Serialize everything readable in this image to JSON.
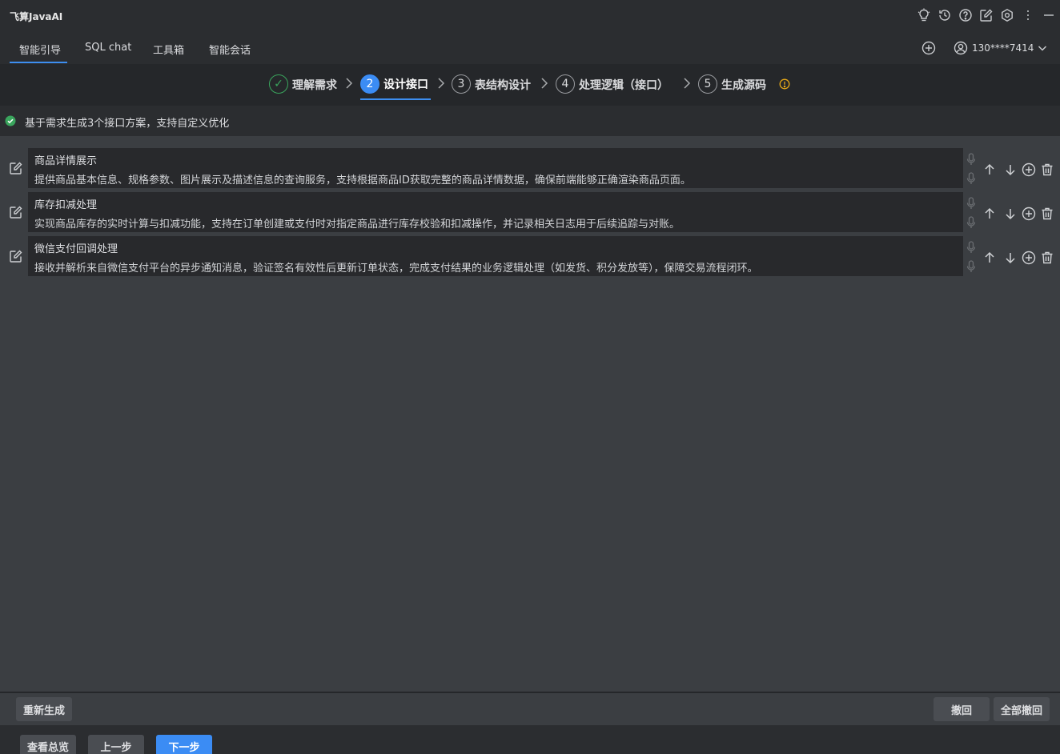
{
  "app": {
    "title": "飞算JavaAI"
  },
  "tabs": [
    {
      "label": "智能引导"
    },
    {
      "label": "SQL chat"
    },
    {
      "label": "工具箱"
    },
    {
      "label": "智能会话"
    }
  ],
  "user": {
    "label": "130****7414"
  },
  "steps": [
    {
      "number": "✓",
      "label": "理解需求"
    },
    {
      "number": "2",
      "label": "设计接口"
    },
    {
      "number": "3",
      "label": "表结构设计"
    },
    {
      "number": "4",
      "label": "处理逻辑（接口）"
    },
    {
      "number": "5",
      "label": "生成源码"
    }
  ],
  "info": {
    "text": "基于需求生成3个接口方案，支持自定义优化"
  },
  "interfaces": [
    {
      "title": "商品详情展示",
      "description": "提供商品基本信息、规格参数、图片展示及描述信息的查询服务，支持根据商品ID获取完整的商品详情数据，确保前端能够正确渲染商品页面。"
    },
    {
      "title": "库存扣减处理",
      "description": "实现商品库存的实时计算与扣减功能，支持在订单创建或支付时对指定商品进行库存校验和扣减操作，并记录相关日志用于后续追踪与对账。"
    },
    {
      "title": "微信支付回调处理",
      "description": "接收并解析来自微信支付平台的异步通知消息，验证签名有效性后更新订单状态，完成支付结果的业务逻辑处理（如发货、积分发放等），保障交易流程闭环。"
    }
  ],
  "buttons": {
    "regenerate": "重新生成",
    "undo": "撤回",
    "undo_all": "全部撤回",
    "overview": "查看总览",
    "prev": "上一步",
    "next": "下一步"
  },
  "colors": {
    "accent": "#3b8cf4",
    "success": "#3aa55d",
    "warning": "#e6a817"
  }
}
